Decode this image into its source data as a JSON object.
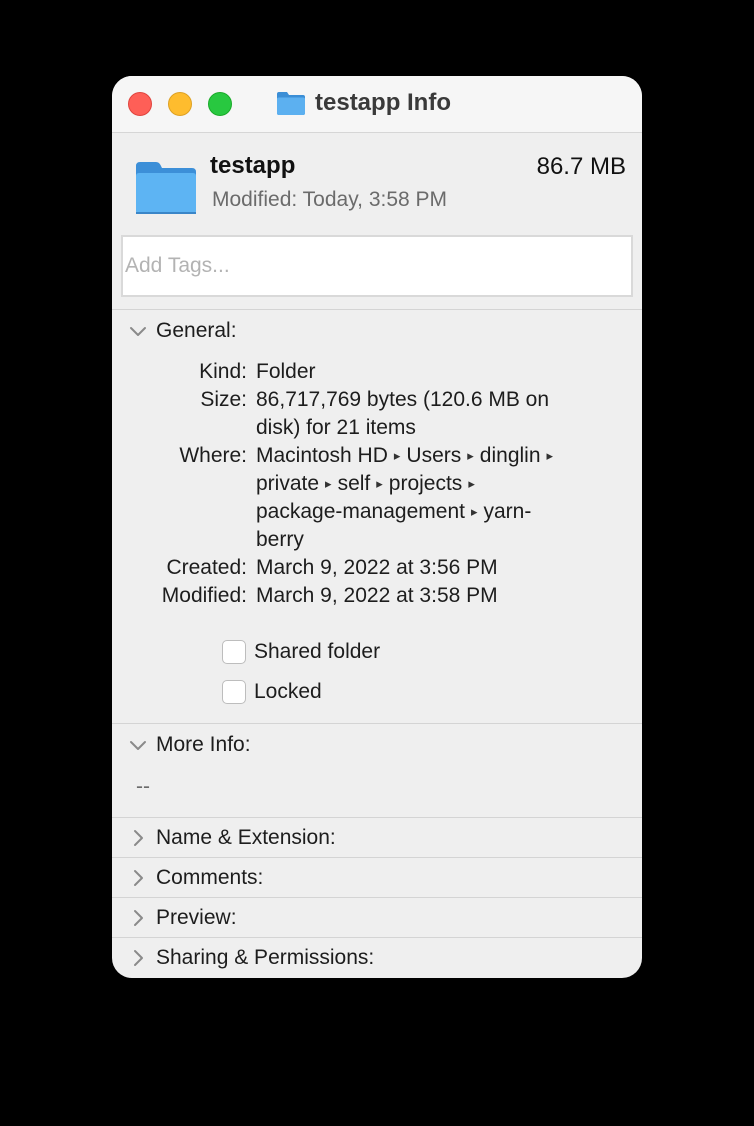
{
  "window": {
    "title": "testapp Info"
  },
  "header": {
    "name": "testapp",
    "size": "86.7 MB",
    "modified": "Modified: Today, 3:58 PM"
  },
  "tags": {
    "placeholder": "Add Tags...",
    "value": ""
  },
  "general": {
    "label": "General:",
    "kind_label": "Kind:",
    "kind_value": "Folder",
    "size_label": "Size:",
    "size_line1": "86,717,769 bytes (120.6 MB on",
    "size_line2": "disk) for 21 items",
    "where_label": "Where:",
    "where_line1": [
      "Macintosh HD",
      "Users",
      "dinglin"
    ],
    "where_line2": [
      "private",
      "self",
      "projects"
    ],
    "where_line3": [
      "package-management",
      "yarn-"
    ],
    "where_line4": "berry",
    "path_separator": "▸",
    "created_label": "Created:",
    "created_value": "March 9, 2022 at 3:56 PM",
    "modified_label": "Modified:",
    "modified_value": "March 9, 2022 at 3:58 PM",
    "shared_label": "Shared folder",
    "shared_checked": false,
    "locked_label": "Locked",
    "locked_checked": false
  },
  "more_info": {
    "label": "More Info:",
    "value": "--"
  },
  "sections": {
    "name_ext": "Name & Extension:",
    "comments": "Comments:",
    "preview": "Preview:",
    "sharing": "Sharing & Permissions:"
  },
  "colors": {
    "close": "#fe5f57",
    "minimize": "#febc2e",
    "maximize": "#28c840",
    "folder": "#4fa3e8",
    "window_bg": "#efefef"
  },
  "icons": {
    "folder": "folder-icon",
    "expanded": "chevron-down-icon",
    "collapsed": "chevron-right-icon"
  }
}
